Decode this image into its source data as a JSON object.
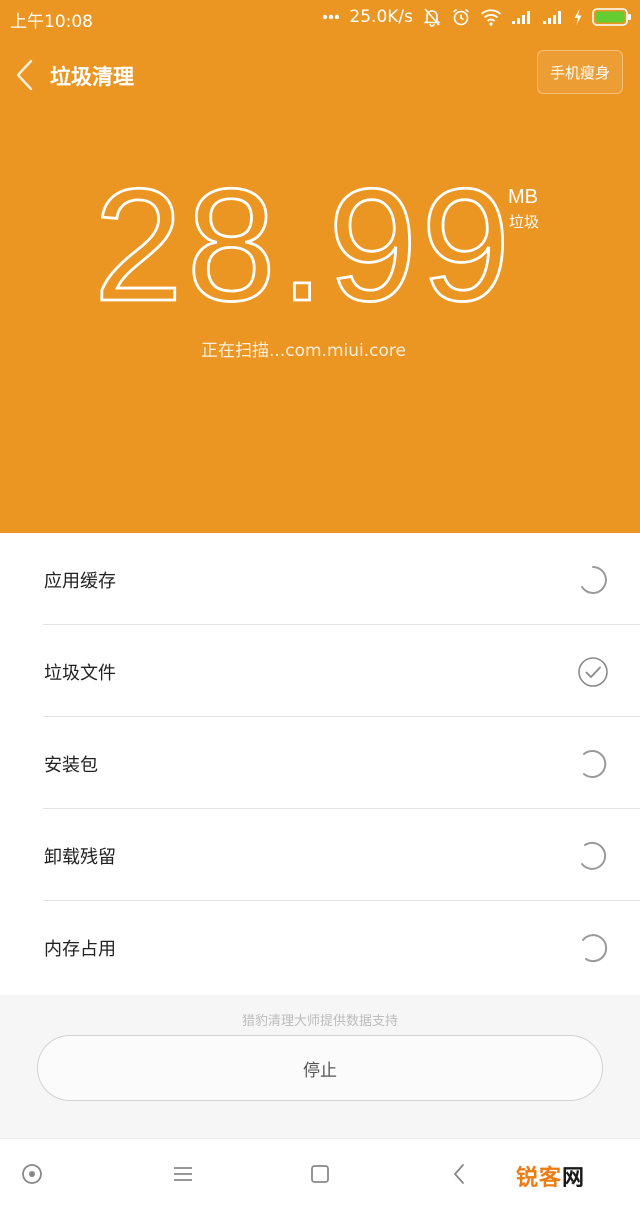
{
  "status_bar": {
    "time": "上午10:08",
    "network_speed": "25.0K/s",
    "icons": [
      "more-dots-icon",
      "mute-bell-icon",
      "alarm-icon",
      "wifi-icon",
      "signal-icon",
      "signal-icon",
      "charging-icon",
      "battery-icon"
    ]
  },
  "header": {
    "title": "垃圾清理",
    "action_label": "手机瘦身",
    "background_color": "#eb9623"
  },
  "scan": {
    "junk_size": "28.99",
    "unit": "MB",
    "unit_sub": "垃圾",
    "status_text": "正在扫描...com.miui.core"
  },
  "categories": [
    {
      "label": "应用缓存",
      "state": "scanning"
    },
    {
      "label": "垃圾文件",
      "state": "done"
    },
    {
      "label": "安装包",
      "state": "scanning"
    },
    {
      "label": "卸载残留",
      "state": "scanning"
    },
    {
      "label": "内存占用",
      "state": "scanning"
    }
  ],
  "footer": {
    "provider": "猎豹清理大师提供数据支持",
    "stop_label": "停止"
  },
  "nav_bar": {
    "icons": [
      "circle-dot-icon",
      "menu-icon",
      "square-icon",
      "back-chevron-icon"
    ]
  },
  "watermark": {
    "text_a": "锐客",
    "text_b": "网"
  }
}
